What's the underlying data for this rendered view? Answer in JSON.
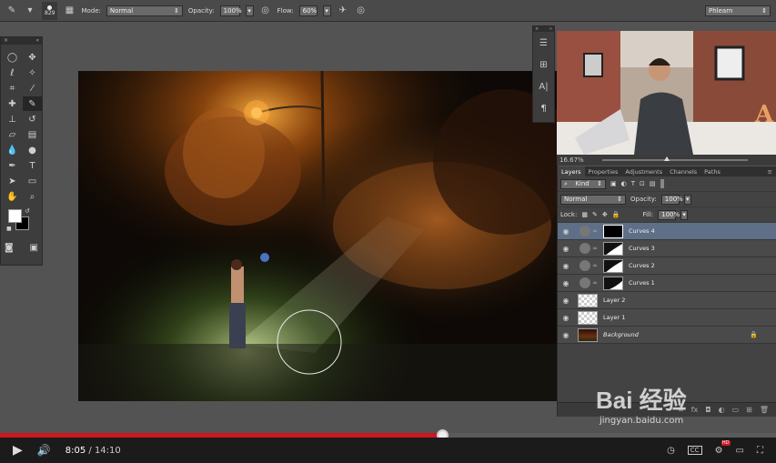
{
  "options_bar": {
    "brush_size": "829",
    "mode_label": "Mode:",
    "mode_value": "Normal",
    "opacity_label": "Opacity:",
    "opacity_value": "100%",
    "flow_label": "Flow:",
    "flow_value": "60%",
    "workspace": "Phlearn"
  },
  "mini_panel": {
    "char_label": "A|",
    "para_label": "¶"
  },
  "zoom_readout": "16.67%",
  "layers_panel": {
    "tabs": [
      "Layers",
      "Properties",
      "Adjustments",
      "Channels",
      "Paths"
    ],
    "filter_kind": "Kind",
    "blend_mode": "Normal",
    "opacity_label": "Opacity:",
    "opacity_value": "100%",
    "lock_label": "Lock:",
    "fill_label": "Fill:",
    "fill_value": "100%",
    "layers": [
      {
        "name": "Curves 4",
        "kind": "curves",
        "mask": "black",
        "selected": true
      },
      {
        "name": "Curves 3",
        "kind": "curves",
        "mask": "curve"
      },
      {
        "name": "Curves 2",
        "kind": "curves",
        "mask": "curve"
      },
      {
        "name": "Curves 1",
        "kind": "curves",
        "mask": "curve"
      },
      {
        "name": "Layer 2",
        "kind": "pixel",
        "thumb": "checker"
      },
      {
        "name": "Layer 1",
        "kind": "pixel",
        "thumb": "checker"
      },
      {
        "name": "Background",
        "kind": "background",
        "thumb": "photo",
        "locked": true
      }
    ]
  },
  "video_player": {
    "current_time": "8:05",
    "separator": " / ",
    "duration": "14:10",
    "progress_fraction": 0.57,
    "hd_badge": "HD"
  },
  "watermark": {
    "brand": "Bai  经验",
    "url": "jingyan.baidu.com"
  }
}
